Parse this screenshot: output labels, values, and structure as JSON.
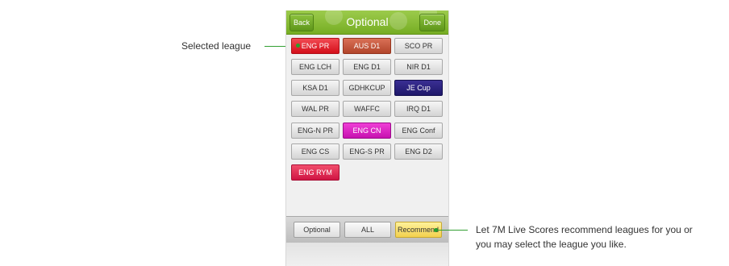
{
  "header": {
    "title": "Optional",
    "back_label": "Back",
    "done_label": "Done"
  },
  "leagues": [
    [
      "ENG PR",
      "AUS D1",
      "SCO PR"
    ],
    [
      "ENG LCH",
      "ENG D1",
      "NIR D1"
    ],
    [
      "KSA D1",
      "GDHKCUP",
      "JE Cup"
    ],
    [
      "WAL PR",
      "WAFFC",
      "IRQ D1"
    ],
    [
      "ENG-N PR",
      "ENG CN",
      "ENG Conf"
    ],
    [
      "ENG CS",
      "ENG-S PR",
      "ENG D2"
    ],
    [
      "ENG RYM"
    ]
  ],
  "footer": {
    "optional_label": "Optional",
    "all_label": "ALL",
    "recommend_label": "Recommend"
  },
  "callouts": {
    "selected": "Selected league",
    "recommend_line1": "Let 7M Live Scores recommend leagues for you or",
    "recommend_line2": "you may select the league you like."
  },
  "colors": {
    "accent_green": "#76ad23",
    "selected_red": "#d40f1a",
    "navy": "#1f186a",
    "magenta": "#c711b0",
    "crimson": "#cf1443",
    "recommend_yellow": "#f2d04e"
  }
}
